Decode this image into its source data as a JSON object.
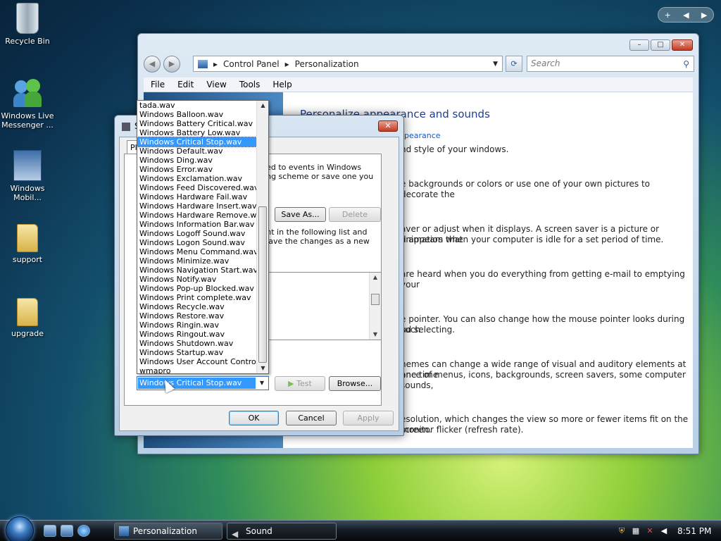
{
  "desktop": {
    "icons": [
      {
        "label": "Recycle Bin"
      },
      {
        "label": "Windows Live Messenger ..."
      },
      {
        "label": "Windows Mobil..."
      },
      {
        "label": "support"
      },
      {
        "label": "upgrade"
      }
    ],
    "gadget_controls": {
      "add": "+",
      "prev": "◀",
      "next": "▶"
    }
  },
  "control_panel": {
    "breadcrumb": [
      "Control Panel",
      "Personalization"
    ],
    "search_placeholder": "Search",
    "menu": [
      "File",
      "Edit",
      "View",
      "Tools",
      "Help"
    ],
    "heading": "Personalize appearance and sounds",
    "link_fragment": "pearance",
    "texts": [
      "nd style of your windows.",
      "e backgrounds or colors or use one of your own pictures to decorate the",
      "aver or adjust when it displays. A screen saver is a picture or animation that",
      "d appears when your computer is idle for a set period of time.",
      " are heard when you do everything from getting e-mail to emptying your",
      "e pointer. You can also change how the mouse pointer looks during such",
      "nd selecting.",
      "hemes can change a wide range of visual and auditory elements at one time",
      "ance of menus, icons, backgrounds, screen savers, some computer sounds,",
      "esolution, which changes the view so more or fewer items fit on the screen.",
      "monitor flicker (refresh rate)."
    ]
  },
  "sound_dialog": {
    "title_fragment": "S",
    "tab_label": "Pla",
    "panel_text_1": [
      "plied to events in Windows",
      "sting scheme or save one you"
    ],
    "panel_text_2": [
      "vent in the following list and",
      "n save the changes as a new"
    ],
    "buttons": {
      "save_as": "Save As...",
      "delete": "Delete",
      "test": "Test",
      "browse": "Browse...",
      "ok": "OK",
      "cancel": "Cancel",
      "apply": "Apply"
    },
    "sound_combo_value": "Windows Critical Stop.wav",
    "sound_list": [
      "tada.wav",
      "Windows Balloon.wav",
      "Windows Battery Critical.wav",
      "Windows Battery Low.wav",
      "Windows Critical Stop.wav",
      "Windows Default.wav",
      "Windows Ding.wav",
      "Windows Error.wav",
      "Windows Exclamation.wav",
      "Windows Feed Discovered.wav",
      "Windows Hardware Fail.wav",
      "Windows Hardware Insert.wav",
      "Windows Hardware Remove.wav",
      "Windows Information Bar.wav",
      "Windows Logoff Sound.wav",
      "Windows Logon Sound.wav",
      "Windows Menu Command.wav",
      "Windows Minimize.wav",
      "Windows Navigation Start.wav",
      "Windows Notify.wav",
      "Windows Pop-up Blocked.wav",
      "Windows Print complete.wav",
      "Windows Recycle.wav",
      "Windows Restore.wav",
      "Windows Ringin.wav",
      "Windows Ringout.wav",
      "Windows Shutdown.wav",
      "Windows Startup.wav",
      "Windows User Account Control.wav",
      "wmapro"
    ],
    "selected_index": 4
  },
  "taskbar": {
    "tasks": [
      {
        "label": "Personalization",
        "active": false
      },
      {
        "label": "Sound",
        "active": true
      }
    ],
    "clock": "8:51 PM"
  }
}
